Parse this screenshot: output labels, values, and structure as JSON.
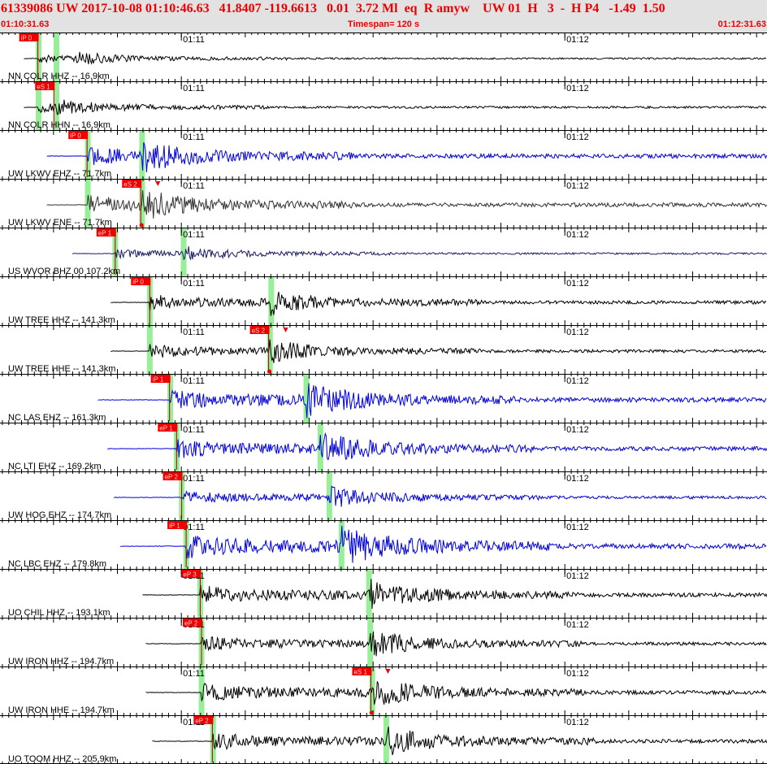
{
  "header": {
    "title": "61339086 UW 2017-10-08 01:10:46.63   41.8407 -119.6613   0.01  3.72 Ml  eq  R amyw    UW 01  H   3  -  H P4   -1.49  1.50",
    "start_time": "01:10:31.63",
    "timespan": "Timespan= 120 s",
    "end_time": "01:12:31.63"
  },
  "time_window": {
    "start_s": 31.63,
    "end_s": 151.63
  },
  "minute_labels": [
    {
      "text": "01:11",
      "t": 60
    },
    {
      "text": "01:12",
      "t": 120
    }
  ],
  "colors": {
    "black_trace": "#000000",
    "blue_trace": "#0000dd",
    "pick": "#ee0000",
    "green_band": "#99ee99",
    "tick": "#000000"
  },
  "traces": [
    {
      "label": "NN COLR HHZ -- 16.9km",
      "color": "black",
      "data_start": 35.4,
      "p": 37.6,
      "s": null,
      "picks": [
        {
          "text": "iP 0",
          "t": 37.3,
          "type": "P"
        }
      ],
      "green": [
        37.6,
        40.4
      ],
      "amp": 0.18
    },
    {
      "label": "NN COLR HHN -- 16.9km",
      "color": "black",
      "data_start": 35.4,
      "p": 37.6,
      "s": 40.4,
      "picks": [
        {
          "text": "eS 1",
          "t": 39.8,
          "type": "S"
        }
      ],
      "green": [
        37.6,
        40.4
      ],
      "amp": 0.22
    },
    {
      "label": "UW LKWV EHZ -- 71.7km",
      "color": "blue",
      "data_start": 39.0,
      "p": 45.3,
      "s": 53.8,
      "picks": [
        {
          "text": "iP 0",
          "t": 45.0,
          "type": "P"
        }
      ],
      "green": [
        45.3,
        53.8
      ],
      "amp": 0.45
    },
    {
      "label": "UW LKWV ENE -- 71.7km",
      "color": "gray",
      "data_start": 39.0,
      "p": 45.3,
      "s": 53.8,
      "picks": [
        {
          "text": "eS 2",
          "t": 53.4,
          "type": "S",
          "marker": true
        }
      ],
      "green": [
        45.3,
        53.8
      ],
      "amp": 0.42
    },
    {
      "label": "US WVOR BHZ 00 107.2km",
      "color": "navy",
      "data_start": 43.0,
      "p": 49.6,
      "s": 60.3,
      "picks": [
        {
          "text": "eP 1",
          "t": 49.4,
          "type": "P"
        }
      ],
      "green": [
        49.6,
        60.3
      ],
      "amp": 0.2
    },
    {
      "label": "UW TREE HHZ -- 141.3km",
      "color": "black",
      "data_start": 49.0,
      "p": 55.0,
      "s": 74.0,
      "picks": [
        {
          "text": "iP 0",
          "t": 54.8,
          "type": "P"
        }
      ],
      "green": [
        55.0,
        74.0
      ],
      "amp": 0.35
    },
    {
      "label": "UW TREE HHE -- 141.3km",
      "color": "black",
      "data_start": 49.0,
      "p": 55.0,
      "s": 73.8,
      "picks": [
        {
          "text": "eS 2",
          "t": 73.4,
          "type": "S",
          "marker": true
        }
      ],
      "green": [
        55.0,
        73.8
      ],
      "amp": 0.32
    },
    {
      "label": "NC LAS EHZ -- 161.3km",
      "color": "blue",
      "data_start": 47.0,
      "p": 58.2,
      "s": 79.5,
      "picks": [
        {
          "text": "iP 1",
          "t": 57.9,
          "type": "P"
        }
      ],
      "green": [
        58.2,
        79.5
      ],
      "amp": 0.48
    },
    {
      "label": "NC LTI EHZ -- 169.2km",
      "color": "blue",
      "data_start": 48.5,
      "p": 59.2,
      "s": 81.7,
      "picks": [
        {
          "text": "eP 1",
          "t": 59.0,
          "type": "P"
        }
      ],
      "green": [
        59.2,
        81.7
      ],
      "amp": 0.45
    },
    {
      "label": "UW HOG EHZ -- 174.7km",
      "color": "blue",
      "data_start": 49.5,
      "p": 60.0,
      "s": 83.1,
      "picks": [
        {
          "text": "eP 2",
          "t": 59.8,
          "type": "P"
        }
      ],
      "green": [
        60.0,
        83.1
      ],
      "amp": 0.3
    },
    {
      "label": "NC LBC EHZ -- 179.8km",
      "color": "blue",
      "data_start": 50.5,
      "p": 60.7,
      "s": 85.0,
      "picks": [
        {
          "text": "iP 1",
          "t": 60.5,
          "type": "P"
        }
      ],
      "green": [
        60.7,
        85.0
      ],
      "amp": 0.55
    },
    {
      "label": "UO CHIL HHZ -- 193.1km",
      "color": "black",
      "data_start": 54.0,
      "p": 62.9,
      "s": 89.3,
      "picks": [
        {
          "text": "eP 3",
          "t": 62.7,
          "type": "P"
        }
      ],
      "green": [
        62.9,
        89.3
      ],
      "amp": 0.42
    },
    {
      "label": "UW IRON HHZ -- 194.7km",
      "color": "black",
      "data_start": 54.5,
      "p": 63.1,
      "s": 89.5,
      "picks": [
        {
          "text": "eP 2",
          "t": 62.9,
          "type": "P"
        }
      ],
      "green": [
        63.1,
        89.5
      ],
      "amp": 0.35
    },
    {
      "label": "UW IRON HHE -- 194.7km",
      "color": "black",
      "data_start": 54.5,
      "p": 63.1,
      "s": 89.8,
      "picks": [
        {
          "text": "eS 1",
          "t": 89.4,
          "type": "S",
          "marker": true
        }
      ],
      "green": [
        63.1,
        89.8
      ],
      "amp": 0.42
    },
    {
      "label": "UO TOOM HHZ -- 205.9km",
      "color": "black",
      "data_start": 55.5,
      "p": 64.9,
      "s": 92.0,
      "picks": [
        {
          "text": "eP 2",
          "t": 64.6,
          "type": "P"
        }
      ],
      "green": [
        64.9,
        92.0
      ],
      "amp": 0.4
    }
  ]
}
